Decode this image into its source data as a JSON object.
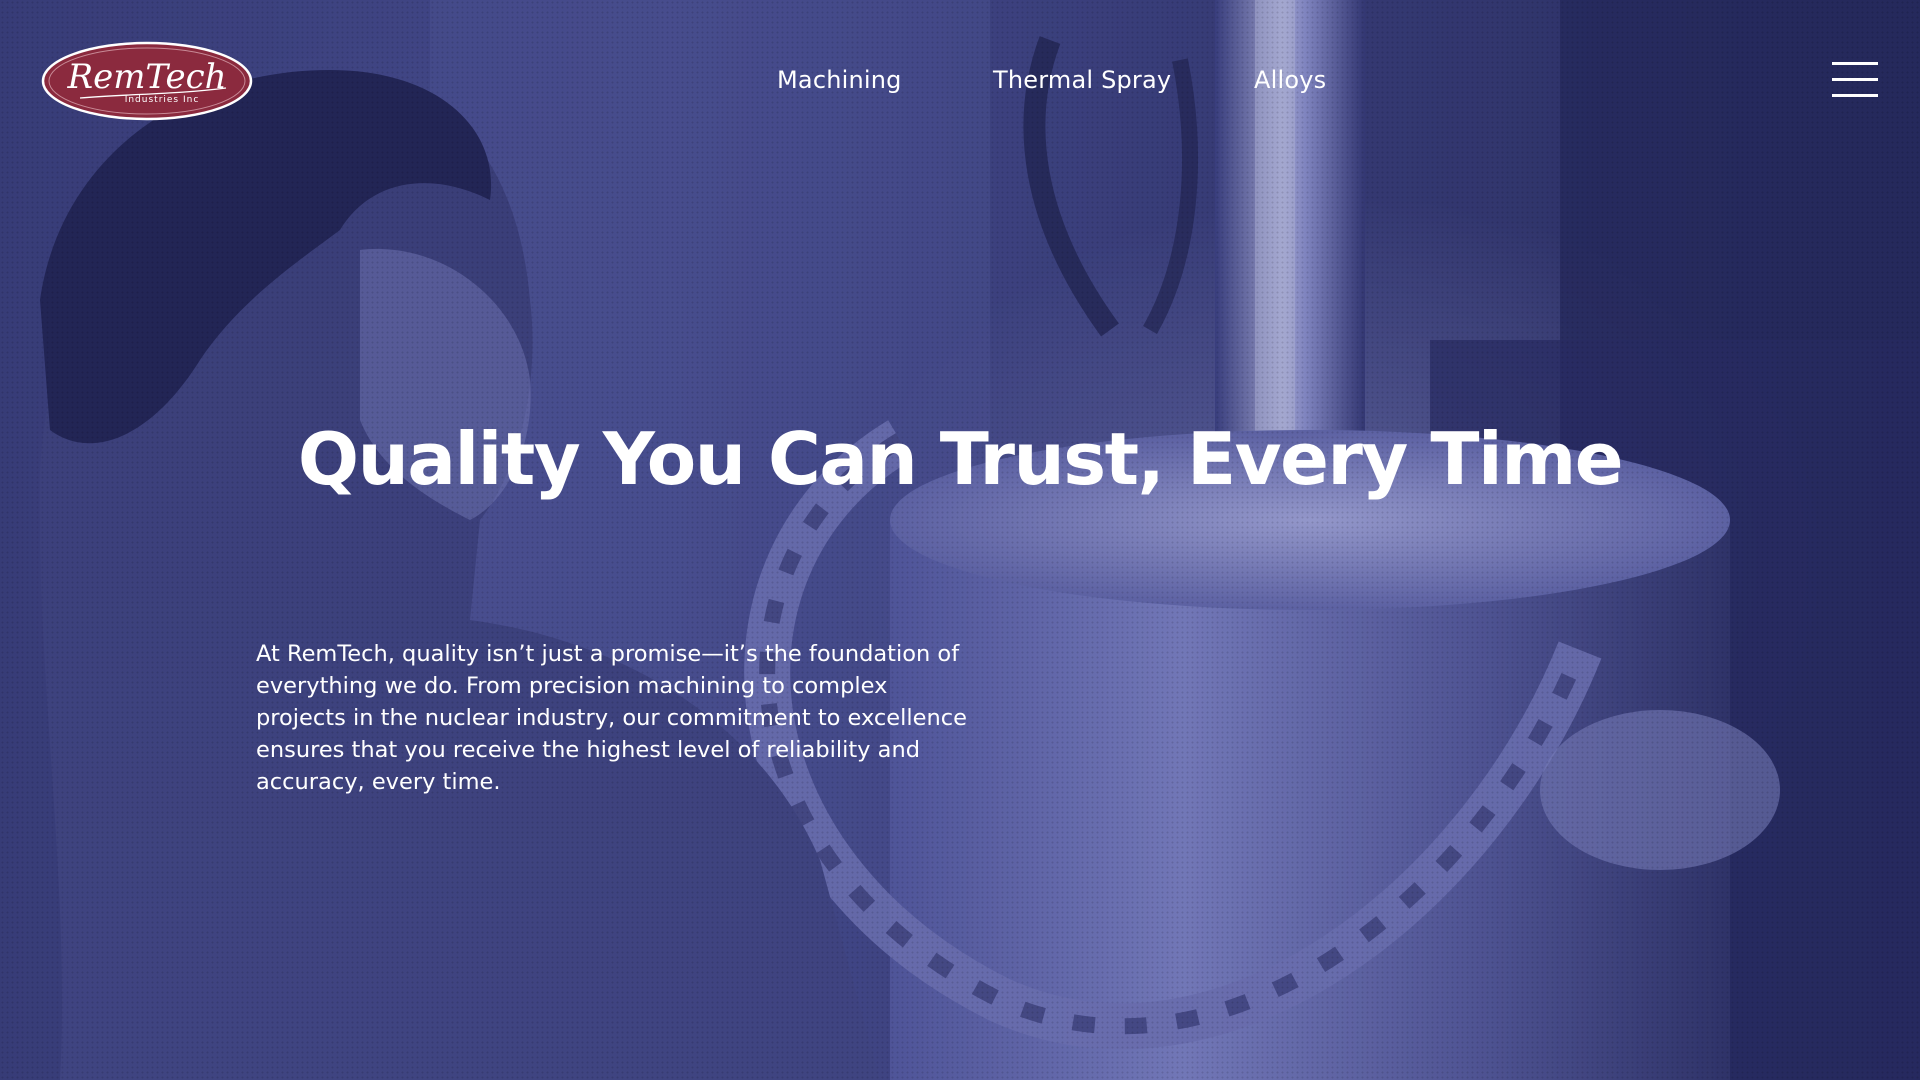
{
  "brand": {
    "logo_text": "RemTech",
    "logo_subtext": "Industries Inc",
    "logo_color": "#8b2a3e"
  },
  "nav": {
    "items": [
      {
        "label": "Machining"
      },
      {
        "label": "Thermal Spray"
      },
      {
        "label": "Alloys"
      }
    ],
    "menu_icon": "hamburger-menu-icon"
  },
  "hero": {
    "headline": "Quality You Can Trust, Every Time",
    "body": "At RemTech, quality isn’t just a promise—it’s the foundation of everything we do. From precision machining to complex projects in the nuclear industry, our commitment to excellence ensures that you receive the highest level of reliability and accuracy, every time.",
    "image_tint": "#3f4486",
    "text_color": "#ffffff"
  }
}
